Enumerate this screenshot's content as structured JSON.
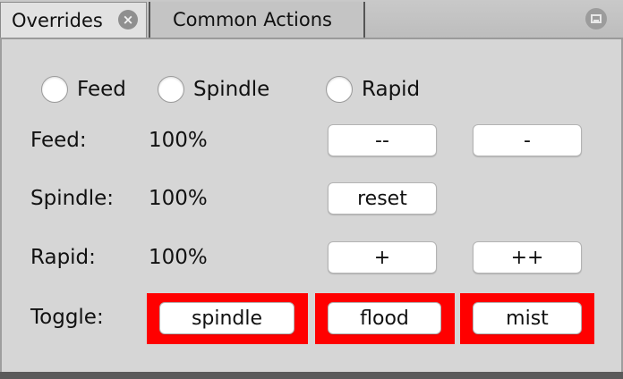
{
  "tabs": [
    {
      "label": "Overrides",
      "active": true
    },
    {
      "label": "Common Actions",
      "active": false
    }
  ],
  "radios": {
    "feed": "Feed",
    "spindle": "Spindle",
    "rapid": "Rapid"
  },
  "rows": {
    "feed": {
      "label": "Feed:",
      "value": "100%"
    },
    "spindle": {
      "label": "Spindle:",
      "value": "100%"
    },
    "rapid": {
      "label": "Rapid:",
      "value": "100%"
    },
    "toggle": {
      "label": "Toggle:"
    }
  },
  "buttons": {
    "coarse_decrease": "--",
    "fine_decrease": "-",
    "reset": "reset",
    "fine_increase": "+",
    "coarse_increase": "++"
  },
  "toggles": {
    "spindle": "spindle",
    "flood": "flood",
    "mist": "mist",
    "highlight_color": "#ff0000"
  }
}
